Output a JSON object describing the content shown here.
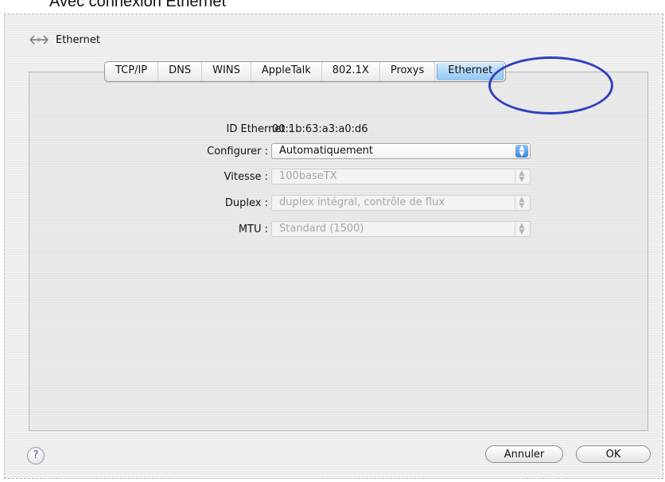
{
  "caption": "Avec connexion Ethernet",
  "header": {
    "title": "Ethernet",
    "icon": "ethernet-arrows-icon"
  },
  "tabs": [
    {
      "label": "TCP/IP",
      "active": false
    },
    {
      "label": "DNS",
      "active": false
    },
    {
      "label": "WINS",
      "active": false
    },
    {
      "label": "AppleTalk",
      "active": false
    },
    {
      "label": "802.1X",
      "active": false
    },
    {
      "label": "Proxys",
      "active": false
    },
    {
      "label": "Ethernet",
      "active": true
    }
  ],
  "form": {
    "ethernet_id": {
      "label": "ID Ethernet :",
      "value": "00:1b:63:a3:a0:d6"
    },
    "configure": {
      "label": "Configurer :",
      "value": "Automatiquement",
      "enabled": true
    },
    "speed": {
      "label": "Vitesse :",
      "value": "100baseTX",
      "enabled": false
    },
    "duplex": {
      "label": "Duplex :",
      "value": "duplex intégral, contrôle de flux",
      "enabled": false
    },
    "mtu": {
      "label": "MTU :",
      "value": "Standard  (1500)",
      "enabled": false
    }
  },
  "footer": {
    "help_symbol": "?",
    "cancel_label": "Annuler",
    "ok_label": "OK"
  },
  "colors": {
    "highlight_ring": "#2f3fbf",
    "active_tab": "#8ec6f3",
    "stepper_blue": "#3b82dc"
  }
}
